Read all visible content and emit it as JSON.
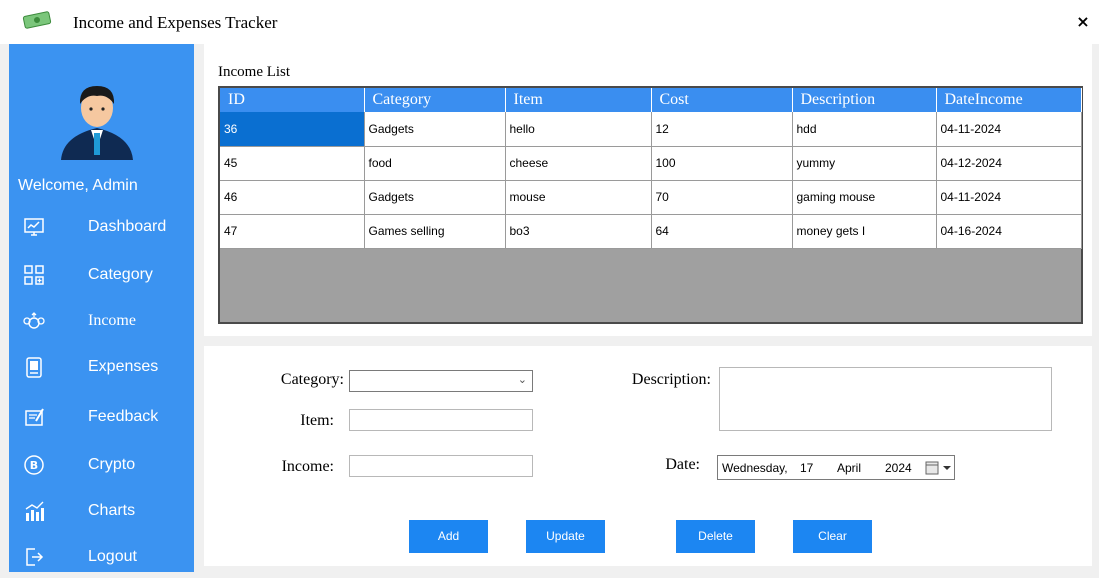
{
  "window": {
    "title": "Income and Expenses Tracker",
    "close_label": "×"
  },
  "sidebar": {
    "welcome": "Welcome, Admin",
    "items": [
      {
        "label": "Dashboard",
        "icon": "dashboard-icon"
      },
      {
        "label": "Category",
        "icon": "category-icon"
      },
      {
        "label": "Income",
        "icon": "income-icon"
      },
      {
        "label": "Expenses",
        "icon": "expenses-icon"
      },
      {
        "label": "Feedback",
        "icon": "feedback-icon"
      },
      {
        "label": "Crypto",
        "icon": "crypto-icon"
      },
      {
        "label": "Charts",
        "icon": "charts-icon"
      },
      {
        "label": "Logout",
        "icon": "logout-icon"
      }
    ]
  },
  "income_list": {
    "title": "Income List",
    "columns": [
      "ID",
      "Category",
      "Item",
      "Cost",
      "Description",
      "DateIncome"
    ],
    "rows": [
      [
        "36",
        "Gadgets",
        "hello",
        "12",
        "hdd",
        "04-11-2024"
      ],
      [
        "45",
        "food",
        "cheese",
        "100",
        "yummy",
        "04-12-2024"
      ],
      [
        "46",
        "Gadgets",
        "mouse",
        "70",
        "gaming mouse",
        "04-11-2024"
      ],
      [
        "47",
        "Games selling",
        "bo3",
        "64",
        "money gets I",
        "04-16-2024"
      ]
    ]
  },
  "form": {
    "category_label": "Category:",
    "category_value": "",
    "item_label": "Item:",
    "item_value": "",
    "income_label": "Income:",
    "income_value": "",
    "description_label": "Description:",
    "date_label": "Date:",
    "date": {
      "weekday": "Wednesday,",
      "day": "17",
      "month": "April",
      "year": "2024"
    }
  },
  "buttons": {
    "add": "Add",
    "update": "Update",
    "delete": "Delete",
    "clear": "Clear"
  },
  "colors": {
    "sidebar": "#3b93f1",
    "header": "#3a8ef0",
    "selection": "#0a6fd1",
    "button": "#1c86f2"
  }
}
